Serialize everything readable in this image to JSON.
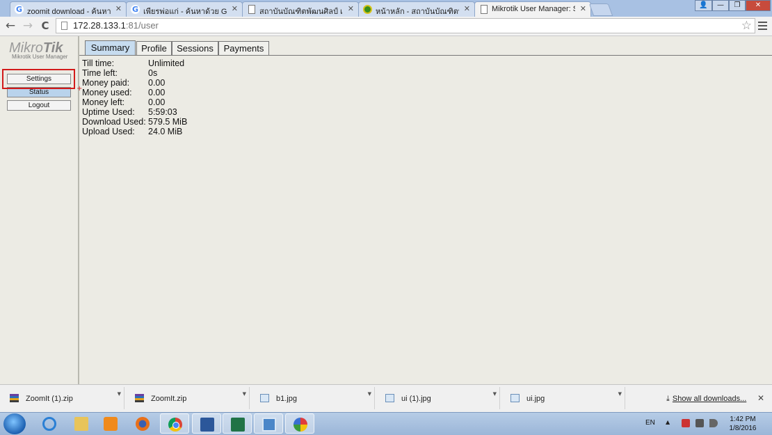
{
  "browser": {
    "tabs": [
      {
        "title": "zoomit download - ค้นหาด้",
        "icon": "google-icon"
      },
      {
        "title": "เพียรพ่อแก่ - ค้นหาด้วย Goog",
        "icon": "google-icon"
      },
      {
        "title": "สถาบันบัณฑิตพัฒนศิลป์ เว็บไซ",
        "icon": "document-icon"
      },
      {
        "title": "หน้าหลัก - สถาบันบัณฑิตพัฒน",
        "icon": "site-logo-icon"
      },
      {
        "title": "Mikrotik User Manager: St",
        "icon": "document-icon"
      }
    ],
    "tab_close": "✕",
    "window_controls": {
      "user": "👤",
      "minimize": "—",
      "restore": "❐",
      "close": "✕"
    },
    "nav": {
      "back": "←",
      "forward": "→",
      "reload": "C"
    },
    "address": {
      "host": "172.28.133.1",
      "path": ":81/user"
    },
    "star": "☆"
  },
  "sidebar": {
    "logo_main": "Mikro",
    "logo_bold": "Tik",
    "logo_sub": "Mikrotik User Manager",
    "buttons": {
      "settings": "Settings",
      "status": "Status",
      "logout": "Logout"
    },
    "annotation_mark": "+"
  },
  "page_tabs": [
    {
      "label": "Summary"
    },
    {
      "label": "Profile"
    },
    {
      "label": "Sessions"
    },
    {
      "label": "Payments"
    }
  ],
  "summary": [
    {
      "label": "Till time:",
      "value": "Unlimited"
    },
    {
      "label": "Time left:",
      "value": "0s"
    },
    {
      "label": "Money paid:",
      "value": "0.00"
    },
    {
      "label": "Money used:",
      "value": "0.00"
    },
    {
      "label": "Money left:",
      "value": "0.00"
    },
    {
      "label": "Uptime Used:",
      "value": "5:59:03"
    },
    {
      "label": "Download Used:",
      "value": "579.5 MiB"
    },
    {
      "label": "Upload Used:",
      "value": "24.0 MiB"
    }
  ],
  "downloads": {
    "items": [
      {
        "name": "ZoomIt (1).zip",
        "icon": "zip-file-icon"
      },
      {
        "name": "ZoomIt.zip",
        "icon": "zip-file-icon"
      },
      {
        "name": "b1.jpg",
        "icon": "image-file-icon"
      },
      {
        "name": "ui (1).jpg",
        "icon": "image-file-icon"
      },
      {
        "name": "ui.jpg",
        "icon": "image-file-icon"
      }
    ],
    "arrow": "▼",
    "show_all": "Show all downloads...",
    "download_icon": "⤓",
    "close": "✕"
  },
  "taskbar": {
    "apps": [
      "internet-explorer-icon",
      "file-explorer-icon",
      "media-player-icon",
      "firefox-icon",
      "chrome-icon",
      "word-icon",
      "excel-icon",
      "remote-desktop-icon",
      "paint-icon"
    ],
    "language": "EN",
    "tray_arrow": "▲",
    "time": "1:42 PM",
    "date": "1/8/2016"
  },
  "colors": {
    "highlight_box": "#d21a1a",
    "active_tab": "#c7dcef",
    "status_button": "#b9d3ec"
  }
}
